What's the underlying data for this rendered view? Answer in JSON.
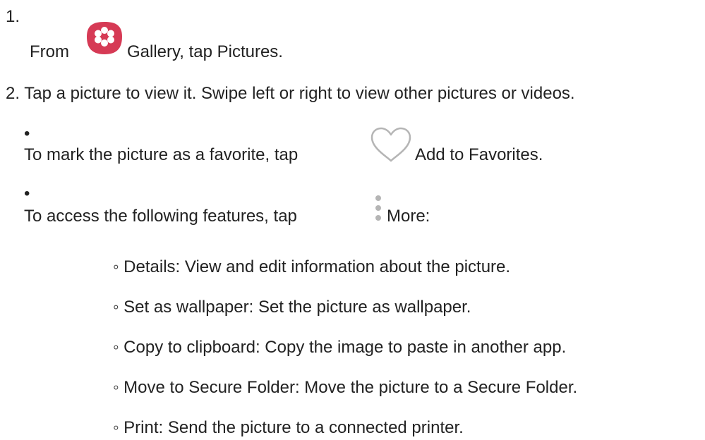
{
  "steps": {
    "step1": {
      "number": "1.",
      "prefix": "From",
      "suffix": "Gallery, tap Pictures.",
      "icon": "gallery-app-icon"
    },
    "step2": {
      "text": "2. Tap a picture to view it. Swipe left or right to view other pictures or videos."
    }
  },
  "bullets": {
    "favorite": {
      "marker": "•",
      "prefix": "To mark the picture as a favorite, tap",
      "suffix": "Add to Favorites.",
      "icon": "heart-outline-icon"
    },
    "more": {
      "marker": "•",
      "prefix": "To access the following features, tap",
      "suffix": "More:",
      "icon": "more-vertical-icon"
    }
  },
  "features": [
    "◦ Details: View and edit information about the picture.",
    "◦ Set as wallpaper: Set the picture as wallpaper.",
    "◦ Copy to clipboard: Copy the image to paste in another app.",
    "◦ Move to Secure Folder: Move the picture to a Secure Folder.",
    "◦ Print: Send the picture to a connected printer."
  ],
  "colors": {
    "text": "#222222",
    "gallery_icon": "#d63a55",
    "icon_gray": "#b5b5b5"
  }
}
